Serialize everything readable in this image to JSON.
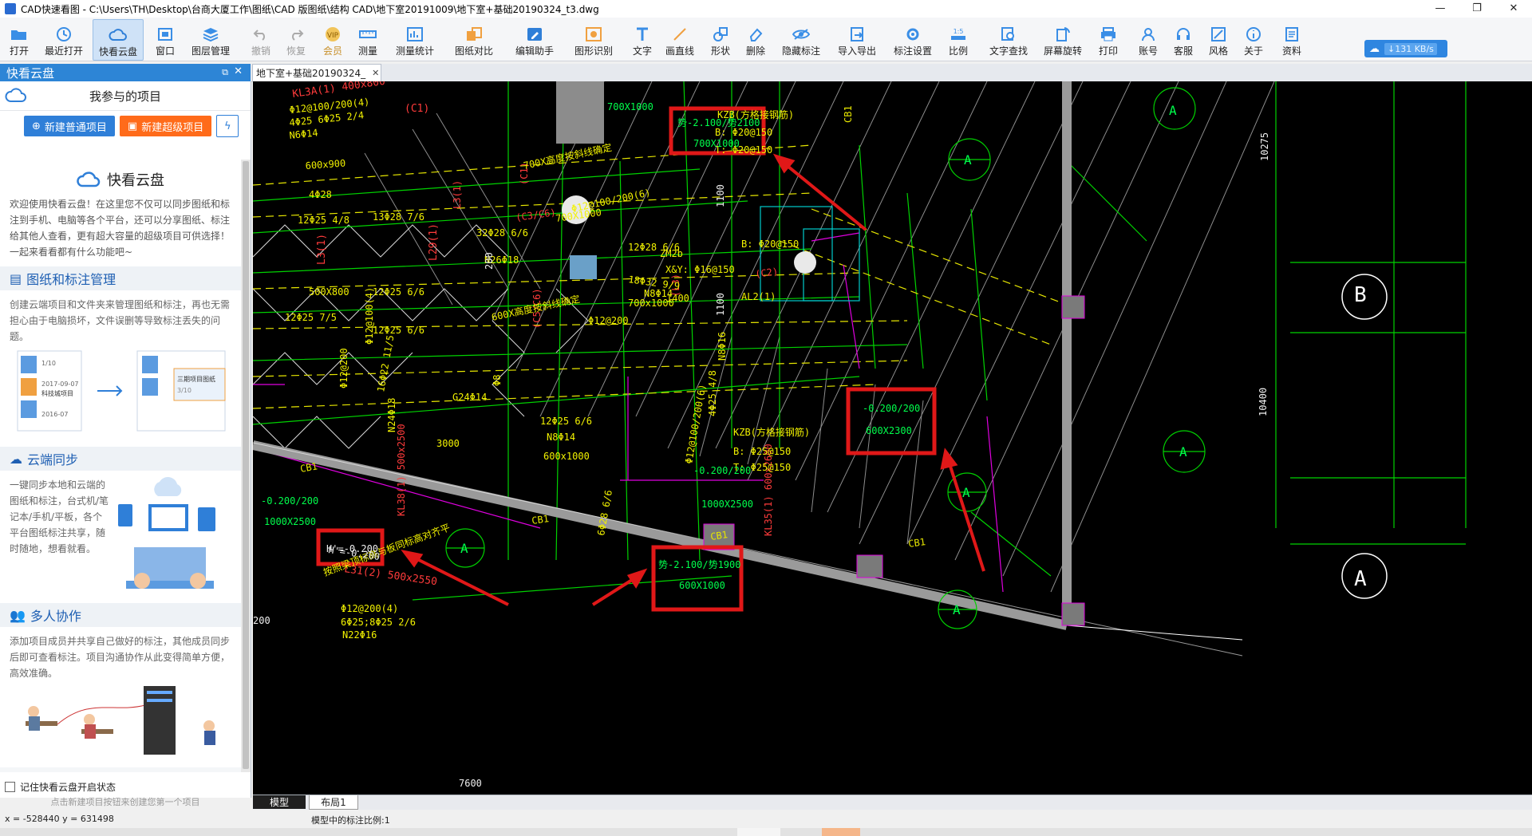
{
  "window": {
    "title": "CAD快速看图 - C:\\Users\\TH\\Desktop\\台商大厦工作\\图纸\\CAD 版图纸\\结构 CAD\\地下室20191009\\地下室+基础20190324_t3.dwg",
    "controls": [
      "—",
      "❐",
      "✕"
    ]
  },
  "toolbar": {
    "items": [
      {
        "label": "打开",
        "icon": "folder-open-icon"
      },
      {
        "label": "最近打开",
        "icon": "history-icon"
      },
      {
        "label": "快看云盘",
        "icon": "cloud-icon",
        "active": true
      },
      {
        "label": "窗口",
        "icon": "window-icon"
      },
      {
        "label": "图层管理",
        "icon": "layers-icon"
      },
      {
        "label": "撤销",
        "icon": "undo-icon",
        "disabled": true
      },
      {
        "label": "恢复",
        "icon": "redo-icon",
        "disabled": true
      },
      {
        "label": "会员",
        "icon": "vip-icon",
        "vip": true
      },
      {
        "label": "测量",
        "icon": "ruler-icon"
      },
      {
        "label": "测量统计",
        "icon": "measure-stats-icon"
      },
      {
        "label": "图纸对比",
        "icon": "compare-icon"
      },
      {
        "label": "编辑助手",
        "icon": "edit-assistant-icon"
      },
      {
        "label": "图形识别",
        "icon": "shape-recognize-icon"
      },
      {
        "label": "文字",
        "icon": "text-icon"
      },
      {
        "label": "画直线",
        "icon": "line-icon"
      },
      {
        "label": "形状",
        "icon": "shape-icon"
      },
      {
        "label": "删除",
        "icon": "eraser-icon"
      },
      {
        "label": "隐藏标注",
        "icon": "hide-eye-icon"
      },
      {
        "label": "导入导出",
        "icon": "import-export-icon"
      },
      {
        "label": "标注设置",
        "icon": "annotation-settings-icon"
      },
      {
        "label": "比例",
        "icon": "scale-icon"
      },
      {
        "label": "文字查找",
        "icon": "text-search-icon"
      },
      {
        "label": "屏幕旋转",
        "icon": "rotate-screen-icon"
      },
      {
        "label": "打印",
        "icon": "printer-icon"
      },
      {
        "label": "账号",
        "icon": "account-icon"
      },
      {
        "label": "客服",
        "icon": "headset-icon"
      },
      {
        "label": "风格",
        "icon": "style-icon"
      },
      {
        "label": "关于",
        "icon": "info-icon"
      },
      {
        "label": "资料",
        "icon": "document-icon"
      }
    ],
    "speed": "↓131 KB/s"
  },
  "sidebar": {
    "header": "快看云盘",
    "my_projects": "我参与的项目",
    "new_normal": "新建普通项目",
    "new_super": "新建超级项目",
    "intro_title": "快看云盘",
    "intro_text": "欢迎使用快看云盘！在这里您不仅可以同步图纸和标注到手机、电脑等各个平台，还可以分享图纸、标注给其他人查看，更有超大容量的超级项目可供选择！一起来看看都有什么功能吧~",
    "sections": [
      {
        "title": "图纸和标注管理",
        "text": "创建云端项目和文件夹来管理图纸和标注，再也无需担心由于电脑损坏，文件误删等导致标注丢失的问题。"
      },
      {
        "title": "云端同步",
        "text": "一键同步本地和云端的图纸和标注，台式机/笔记本/手机/平板，各个平台图纸标注共享，随时随地，想看就看。"
      },
      {
        "title": "多人协作",
        "text": "添加项目成员并共享自己做好的标注，其他成员同步后即可查看标注。项目沟通协作从此变得简单方便，高效准确。"
      }
    ],
    "illus_labels": {
      "item1": "科技城项目",
      "item2": "三期项目图纸",
      "date1": "2017-09-07",
      "date2": "2016-07",
      "count": "1/10",
      "count2": "3/10"
    },
    "remember": "记住快看云盘开启状态",
    "hint": "点击新建项目按钮来创建您第一个项目"
  },
  "doc_tab": "地下室+基础20190324_",
  "layout_tabs": [
    "模型",
    "布局1"
  ],
  "status": {
    "coords": "x = -528440  y = 631498",
    "scale": "模型中的标注比例:1"
  },
  "cad": {
    "red_labels": [
      "KL3A(1) 400x800",
      "(C1)",
      "L3(1)",
      "L29(1)",
      "(C5/C6)",
      "L3(1)",
      "KL38(1) 500x2500",
      "KL35(1) 600x2600",
      "L31(2) 500x2550",
      "(L3)",
      "(C2)",
      "(C3/C6)",
      "(C1)"
    ],
    "yellow_labels": [
      "Φ12@100/200(4)",
      "4Φ25 6Φ25 2/4",
      "N6Φ14",
      "600x900",
      "4Φ28",
      "12Φ25 4/8",
      "13Φ28 7/6",
      "32Φ28 6/6",
      "N26Φ18",
      "500X800",
      "12Φ25 6/6",
      "12Φ25 7/5",
      "12Φ25 6/6",
      "700X1000",
      "Φ12@100/200(6)",
      "12Φ28 6/6",
      "18Φ32 9/9",
      "N8Φ14",
      "700x1000",
      "Φ12@200",
      "ZM2b",
      "X&Y: Φ16@150",
      "1400",
      "B: Φ20@150",
      "AL2(1)",
      "KZB(方格接钢筋)",
      "B: Φ20@150",
      "T: Φ20@150",
      "Φ12@100(4)",
      "16Φ22 11/5",
      "N24Φ18",
      "Φ12@200",
      "3000",
      "G24Φ14",
      "12Φ25 6/6",
      "N8Φ14",
      "600x1000",
      "Φ12@100/200(6)",
      "6Φ28 6/6",
      "4Φ25 4/8",
      "N8Φ16",
      "KZB(方格接钢筋)",
      "B: Φ25@150",
      "T: Φ25@150",
      "600X高度按斜线确定",
      "700X高度按斜线确定",
      "Φ8",
      "Φ12@200(4)",
      "6Φ25;8Φ25 2/6",
      "N22Φ16",
      "按照梁顶标高与板同标高对齐平"
    ],
    "white_labels": [
      "10275",
      "10400",
      "7600",
      "200",
      "1100",
      "1100",
      "200",
      "-0.200/200",
      "1000X2500",
      "H'=-0.200",
      "CB1",
      "CB1",
      "CB1",
      "CB1",
      "CB1",
      "1000X2500",
      "700X1000",
      "-0.200/200"
    ],
    "boxes": [
      {
        "t1": "势-2.100/势2100",
        "t2": "700X1000"
      },
      {
        "t1": "-0.200/200",
        "t2": "600X2300"
      },
      {
        "t1": "势-2.100/势1900",
        "t2": "600X1000"
      },
      {
        "t1": "H'=-0.200",
        "t2": ""
      }
    ],
    "axis_bubbles": [
      "A",
      "A",
      "A",
      "A",
      "A",
      "A",
      "A",
      "A",
      "B",
      "A"
    ]
  }
}
